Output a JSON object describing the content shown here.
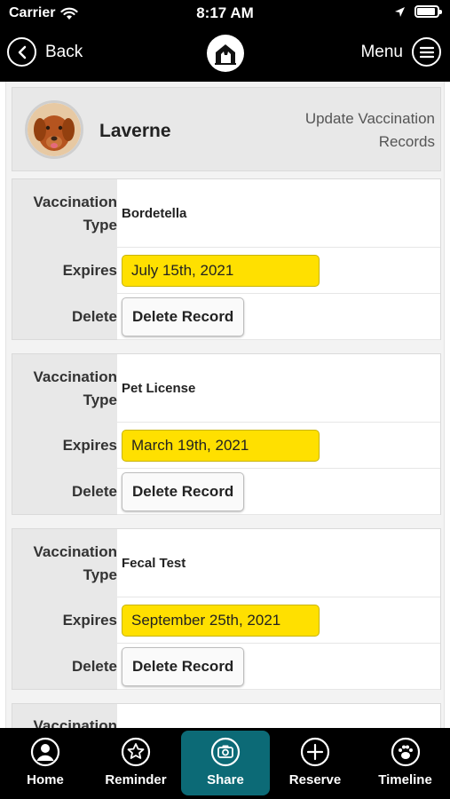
{
  "status_bar": {
    "carrier": "Carrier",
    "time": "8:17 AM",
    "wifi_icon": "wifi-icon",
    "location_icon": "location-arrow-icon",
    "battery_icon": "battery-icon"
  },
  "nav": {
    "back_label": "Back",
    "menu_label": "Menu",
    "logo_icon": "dog-logo-icon"
  },
  "pet": {
    "name": "Laverne",
    "update_link": "Update Vaccination Records"
  },
  "labels": {
    "type": "Vaccination Type",
    "expires": "Expires",
    "delete": "Delete"
  },
  "records": [
    {
      "type": "Bordetella",
      "expires": "July 15th, 2021",
      "delete_label": "Delete Record"
    },
    {
      "type": "Pet License",
      "expires": "March 19th, 2021",
      "delete_label": "Delete Record"
    },
    {
      "type": "Fecal Test",
      "expires": "September 25th, 2021",
      "delete_label": "Delete Record"
    }
  ],
  "partial_record_label": "Vaccination",
  "tabs": [
    {
      "label": "Home",
      "icon": "person-icon",
      "active": false
    },
    {
      "label": "Reminder",
      "icon": "star-icon",
      "active": false
    },
    {
      "label": "Share",
      "icon": "camera-icon",
      "active": true
    },
    {
      "label": "Reserve",
      "icon": "plus-icon",
      "active": false
    },
    {
      "label": "Timeline",
      "icon": "paw-icon",
      "active": false
    }
  ],
  "colors": {
    "accent_yellow": "#ffe000",
    "active_tab": "#0c6a76",
    "bar_black": "#000000"
  }
}
